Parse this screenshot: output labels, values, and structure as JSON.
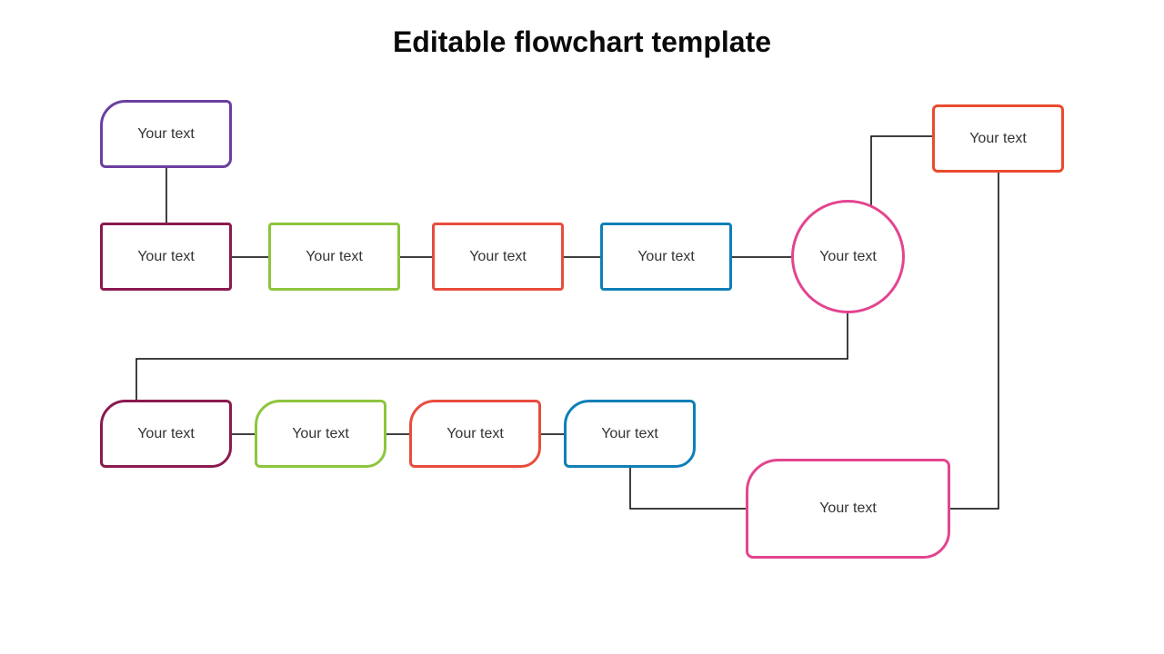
{
  "title": "Editable flowchart template",
  "nodes": {
    "top": {
      "label": "Your text",
      "color": "#6b3fa0"
    },
    "topRight": {
      "label": "Your text",
      "color": "#e94b2f"
    },
    "row2_1": {
      "label": "Your text",
      "color": "#8b1a4f"
    },
    "row2_2": {
      "label": "Your text",
      "color": "#8dc53e"
    },
    "row2_3": {
      "label": "Your text",
      "color": "#e84c3d"
    },
    "row2_4": {
      "label": "Your text",
      "color": "#0f7fb7"
    },
    "row2_5": {
      "label": "Your text",
      "color": "#e3458f"
    },
    "row3_1": {
      "label": "Your text",
      "color": "#8b1a4f"
    },
    "row3_2": {
      "label": "Your text",
      "color": "#8dc53e"
    },
    "row3_3": {
      "label": "Your text",
      "color": "#e84c3d"
    },
    "row3_4": {
      "label": "Your text",
      "color": "#0f7fb7"
    },
    "bottom": {
      "label": "Your text",
      "color": "#e3458f"
    }
  }
}
